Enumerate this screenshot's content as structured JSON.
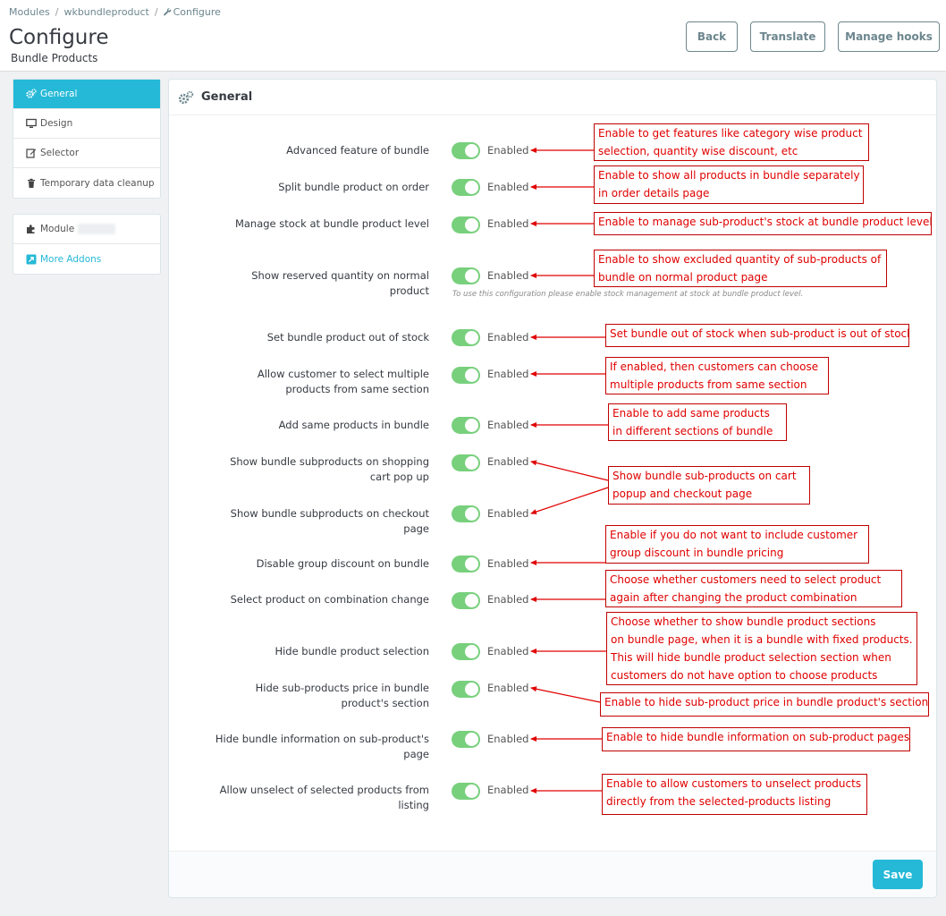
{
  "breadcrumb": [
    "Modules",
    "wkbundleproduct",
    "Configure"
  ],
  "header": {
    "title": "Configure",
    "subtitle": "Bundle Products",
    "buttons": {
      "back": "Back",
      "translate": "Translate",
      "manage_hooks": "Manage hooks"
    }
  },
  "sidebar": {
    "items": [
      "General",
      "Design",
      "Selector",
      "Temporary data cleanup"
    ],
    "secondary": [
      "Module",
      "More Addons"
    ]
  },
  "panel": {
    "title": "General",
    "save_label": "Save",
    "help_text": "To use this configuration please enable stock management at stock at bundle product level."
  },
  "settings": [
    {
      "label": "Advanced feature of bundle",
      "state": "Enabled"
    },
    {
      "label": "Split bundle product on order",
      "state": "Enabled"
    },
    {
      "label": "Manage stock at bundle product level",
      "state": "Enabled"
    },
    {
      "label": "Show reserved quantity on normal product",
      "state": "Enabled"
    },
    {
      "label": "Set bundle product out of stock",
      "state": "Enabled"
    },
    {
      "label": "Allow customer to select multiple products from same section",
      "state": "Enabled"
    },
    {
      "label": "Add same products in bundle",
      "state": "Enabled"
    },
    {
      "label": "Show bundle subproducts on shopping cart pop up",
      "state": "Enabled"
    },
    {
      "label": "Show bundle subproducts on checkout page",
      "state": "Enabled"
    },
    {
      "label": "Disable group discount on bundle",
      "state": "Enabled"
    },
    {
      "label": "Select product on combination change",
      "state": "Enabled"
    },
    {
      "label": "Hide bundle product selection",
      "state": "Enabled"
    },
    {
      "label": "Hide sub-products price in bundle product's section",
      "state": "Enabled"
    },
    {
      "label": "Hide bundle information on sub-product's page",
      "state": "Enabled"
    },
    {
      "label": "Allow unselect of selected products from listing",
      "state": "Enabled"
    }
  ],
  "annotations": [
    {
      "lines": [
        "Enable to get features like category wise product",
        "selection, quantity wise discount, etc"
      ]
    },
    {
      "lines": [
        "Enable to show all products in bundle separately",
        "in order details page"
      ]
    },
    {
      "lines": [
        "Enable to manage sub-product's stock at bundle product level"
      ]
    },
    {
      "lines": [
        "Enable to show excluded quantity of sub-products of",
        "bundle on normal product page"
      ]
    },
    {
      "lines": [
        "Set bundle out of stock when sub-product is out of stock"
      ]
    },
    {
      "lines": [
        "If enabled, then customers can choose",
        "multiple products from same section"
      ]
    },
    {
      "lines": [
        "Enable to add same products",
        "in different sections of bundle"
      ]
    },
    {
      "lines": [
        "Show bundle sub-products on cart",
        "popup and checkout page"
      ]
    },
    {
      "lines": [
        "Enable if you do not want to include customer",
        "group discount in bundle pricing"
      ]
    },
    {
      "lines": [
        "Choose whether customers need to select product",
        "again after changing the product combination"
      ]
    },
    {
      "lines": [
        "Choose whether to show bundle product sections",
        "on bundle page, when it is a bundle with fixed products.",
        "This will hide bundle product selection section when",
        "customers do not have option to choose products"
      ]
    },
    {
      "lines": [
        "Enable to hide sub-product price in bundle product's section"
      ]
    },
    {
      "lines": [
        "Enable to hide bundle information on sub-product pages"
      ]
    },
    {
      "lines": [
        "Enable to allow customers to unselect products",
        "directly from the selected-products listing"
      ]
    }
  ],
  "colors": {
    "accent": "#25b9d7",
    "toggle_on": "#78d07d",
    "annotation": "#e00000"
  }
}
